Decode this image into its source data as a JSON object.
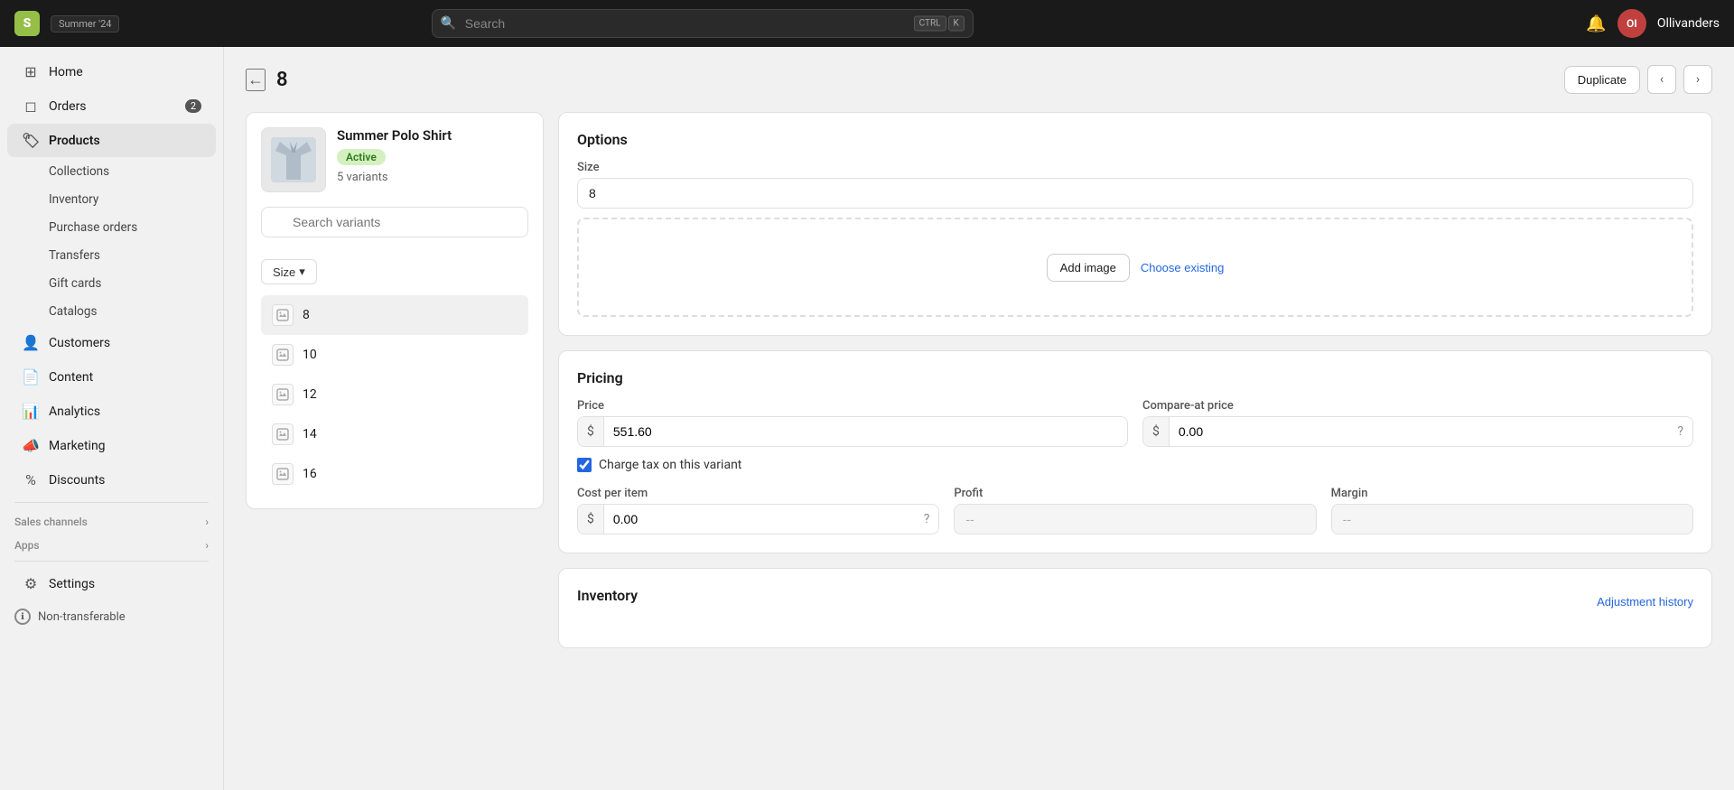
{
  "app": {
    "logo_letter": "S",
    "name": "shopify",
    "badge": "Summer '24",
    "search_placeholder": "Search",
    "search_shortcut_1": "CTRL",
    "search_shortcut_2": "K",
    "user_avatar": "OI",
    "user_name": "Ollivanders"
  },
  "sidebar": {
    "items": [
      {
        "id": "home",
        "label": "Home",
        "icon": "⊞",
        "badge": null
      },
      {
        "id": "orders",
        "label": "Orders",
        "icon": "📦",
        "badge": "2"
      },
      {
        "id": "products",
        "label": "Products",
        "icon": "🏷",
        "badge": null
      },
      {
        "id": "customers",
        "label": "Customers",
        "icon": "👤",
        "badge": null
      },
      {
        "id": "content",
        "label": "Content",
        "icon": "📄",
        "badge": null
      },
      {
        "id": "analytics",
        "label": "Analytics",
        "icon": "📊",
        "badge": null
      },
      {
        "id": "marketing",
        "label": "Marketing",
        "icon": "📣",
        "badge": null
      },
      {
        "id": "discounts",
        "label": "Discounts",
        "icon": "🏷",
        "badge": null
      }
    ],
    "sub_items": [
      {
        "id": "collections",
        "label": "Collections"
      },
      {
        "id": "inventory",
        "label": "Inventory"
      },
      {
        "id": "purchase_orders",
        "label": "Purchase orders"
      },
      {
        "id": "transfers",
        "label": "Transfers"
      },
      {
        "id": "gift_cards",
        "label": "Gift cards"
      },
      {
        "id": "catalogs",
        "label": "Catalogs"
      }
    ],
    "sections": [
      {
        "id": "sales_channels",
        "label": "Sales channels"
      },
      {
        "id": "apps",
        "label": "Apps"
      }
    ],
    "settings_label": "Settings",
    "non_transferable_label": "Non-transferable"
  },
  "page": {
    "title": "8",
    "back_label": "←",
    "duplicate_label": "Duplicate",
    "prev_label": "‹",
    "next_label": "›"
  },
  "product": {
    "name": "Summer Polo Shirt",
    "status": "Active",
    "variants_count": "5 variants"
  },
  "variants": {
    "search_placeholder": "Search variants",
    "filter_label": "Size",
    "filter_chevron": "▾",
    "items": [
      {
        "id": "v8",
        "label": "8",
        "selected": true
      },
      {
        "id": "v10",
        "label": "10",
        "selected": false
      },
      {
        "id": "v12",
        "label": "12",
        "selected": false
      },
      {
        "id": "v14",
        "label": "14",
        "selected": false
      },
      {
        "id": "v16",
        "label": "16",
        "selected": false
      }
    ]
  },
  "options": {
    "section_title": "Options",
    "size_label": "Size",
    "size_value": "8",
    "add_image_label": "Add image",
    "choose_existing_label": "Choose existing"
  },
  "pricing": {
    "section_title": "Pricing",
    "price_label": "Price",
    "price_currency": "$",
    "price_value": "551.60",
    "compare_label": "Compare-at price",
    "compare_currency": "$",
    "compare_value": "0.00",
    "charge_tax_label": "Charge tax on this variant",
    "cost_label": "Cost per item",
    "cost_currency": "$",
    "cost_value": "0.00",
    "profit_label": "Profit",
    "profit_value": "--",
    "margin_label": "Margin",
    "margin_value": "--"
  },
  "inventory": {
    "section_title": "Inventory",
    "adjustment_label": "Adjustment history"
  }
}
